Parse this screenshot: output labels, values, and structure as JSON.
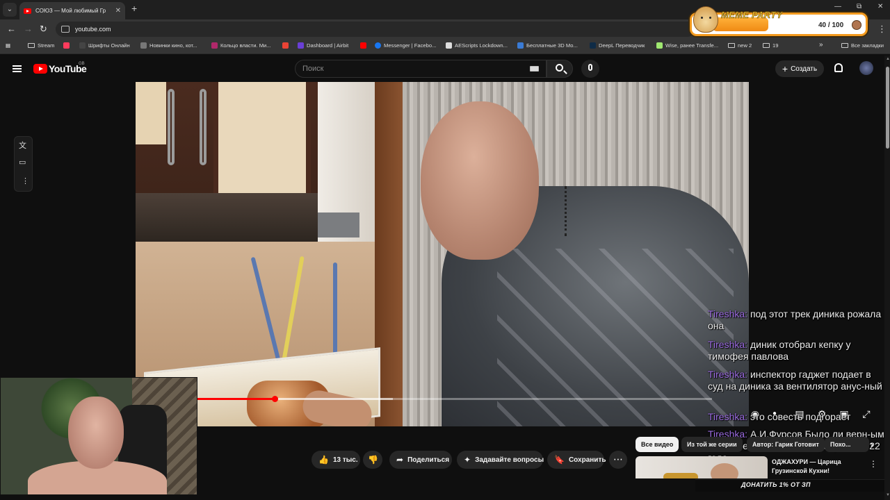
{
  "browser": {
    "tab_title": "СОЮЗ — Мой любимый Гр",
    "new_tab": "+",
    "tab_close": "✕",
    "url": "youtube.com",
    "window_controls": [
      "—",
      "⧉",
      "✕"
    ],
    "bookmarks": [
      {
        "label": "Stream",
        "icon": "folder-icon",
        "color": "#cccccc"
      },
      {
        "label": "Шрифты Онлайн",
        "icon": "bookmark-icon",
        "color": "#ff3b5c"
      },
      {
        "label": "Новинки кино, кот...",
        "icon": "bookmark-icon",
        "color": "#777777"
      },
      {
        "label": "Кольцо власти. Ми...",
        "icon": "bookmark-icon",
        "color": "#b0286a"
      },
      {
        "label": "",
        "icon": "gmail-icon",
        "color": "#ea4335"
      },
      {
        "label": "Dashboard | Airbit",
        "icon": "bookmark-icon",
        "color": "#6a3fd6"
      },
      {
        "label": "",
        "icon": "youtube-icon",
        "color": "#ff0000"
      },
      {
        "label": "Messenger | Facebo...",
        "icon": "messenger-icon",
        "color": "#1877f2"
      },
      {
        "label": "AEScripts Lockdown...",
        "icon": "bookmark-icon",
        "color": "#dddddd"
      },
      {
        "label": "Бесплатные 3D Мо...",
        "icon": "bookmark-icon",
        "color": "#3a7bd5"
      },
      {
        "label": "DeepL Переводчик",
        "icon": "bookmark-icon",
        "color": "#0f2b46"
      },
      {
        "label": "Wise, ранее Transfe...",
        "icon": "bookmark-icon",
        "color": "#9fe870"
      },
      {
        "label": "new 2",
        "icon": "folder-icon",
        "color": "#cccccc"
      },
      {
        "label": "19",
        "icon": "folder-icon",
        "color": "#cccccc"
      }
    ],
    "bookmarks_more": "»",
    "all_bookmarks": "Все закладки"
  },
  "overlay": {
    "meme_title": "MEME PARTY",
    "meme_count": "40 / 100",
    "meme_progress": 0.4,
    "donate": "ДОНАТИТЬ 1% ОТ ЗП"
  },
  "youtube": {
    "logo": "YouTube",
    "region": "GB",
    "search_placeholder": "Поиск",
    "create": "Создать",
    "player": {
      "progress": 0.15,
      "buffered": 0.38
    },
    "actions": {
      "likes": "13 тыс.",
      "share": "Поделиться",
      "ask": "Задавайте вопросы",
      "save": "Сохранить",
      "more": "⋯"
    },
    "chips": [
      "Все видео",
      "Из той же серии",
      "Автор: Гарик Готовит",
      "Похо..."
    ],
    "recommendation": {
      "title": "ОДЖАХУРИ — Царица Грузинской Кухни!"
    }
  },
  "chat": [
    {
      "user": "Tireshka:",
      "text": "под этот трек диника рожала она"
    },
    {
      "user": "Tireshka:",
      "text": "диник отобрал кепку у тимофея павлова"
    },
    {
      "user": "Tireshka:",
      "text": "инспектор гаджет подает в суд на диника за вентилятор анус-ный"
    },
    {
      "user": "Tireshka:",
      "text": "это совесть подгорает"
    },
    {
      "user": "Tireshka:",
      "text": "А.И.Фурсов Было ли верн-ым решение начать СВО в феврале 2022 года"
    }
  ]
}
